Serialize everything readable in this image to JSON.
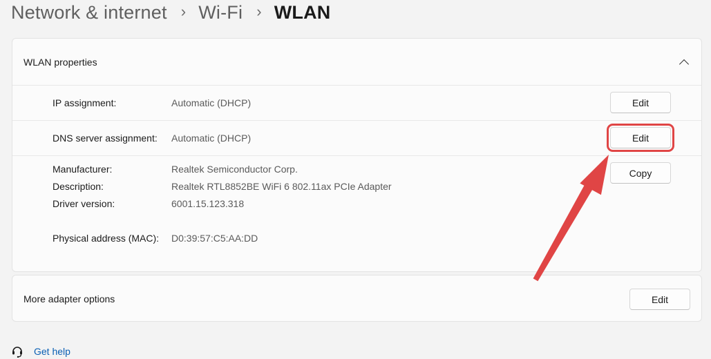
{
  "breadcrumb": {
    "items": [
      "Network & internet",
      "Wi-Fi",
      "WLAN"
    ],
    "separator": "›"
  },
  "wlan_properties": {
    "title": "WLAN properties",
    "rows": [
      {
        "label": "IP assignment:",
        "value": "Automatic (DHCP)",
        "button": "Edit"
      },
      {
        "label": "DNS server assignment:",
        "value": "Automatic (DHCP)",
        "button": "Edit"
      }
    ],
    "details": {
      "manufacturer_label": "Manufacturer:",
      "manufacturer_value": "Realtek Semiconductor Corp.",
      "description_label": "Description:",
      "description_value": "Realtek RTL8852BE WiFi 6 802.11ax PCIe Adapter",
      "driver_label": "Driver version:",
      "driver_value": "6001.15.123.318",
      "mac_label": "Physical address (MAC):",
      "mac_value": "D0:39:57:C5:AA:DD",
      "copy_button": "Copy"
    }
  },
  "more_adapter_options": {
    "title": "More adapter options",
    "button": "Edit"
  },
  "help": {
    "label": "Get help"
  },
  "colors": {
    "highlight": "#e04545",
    "link": "#0a5fb4",
    "background": "#f3f3f3"
  },
  "icons": [
    "chevron-up-icon",
    "help-icon"
  ]
}
